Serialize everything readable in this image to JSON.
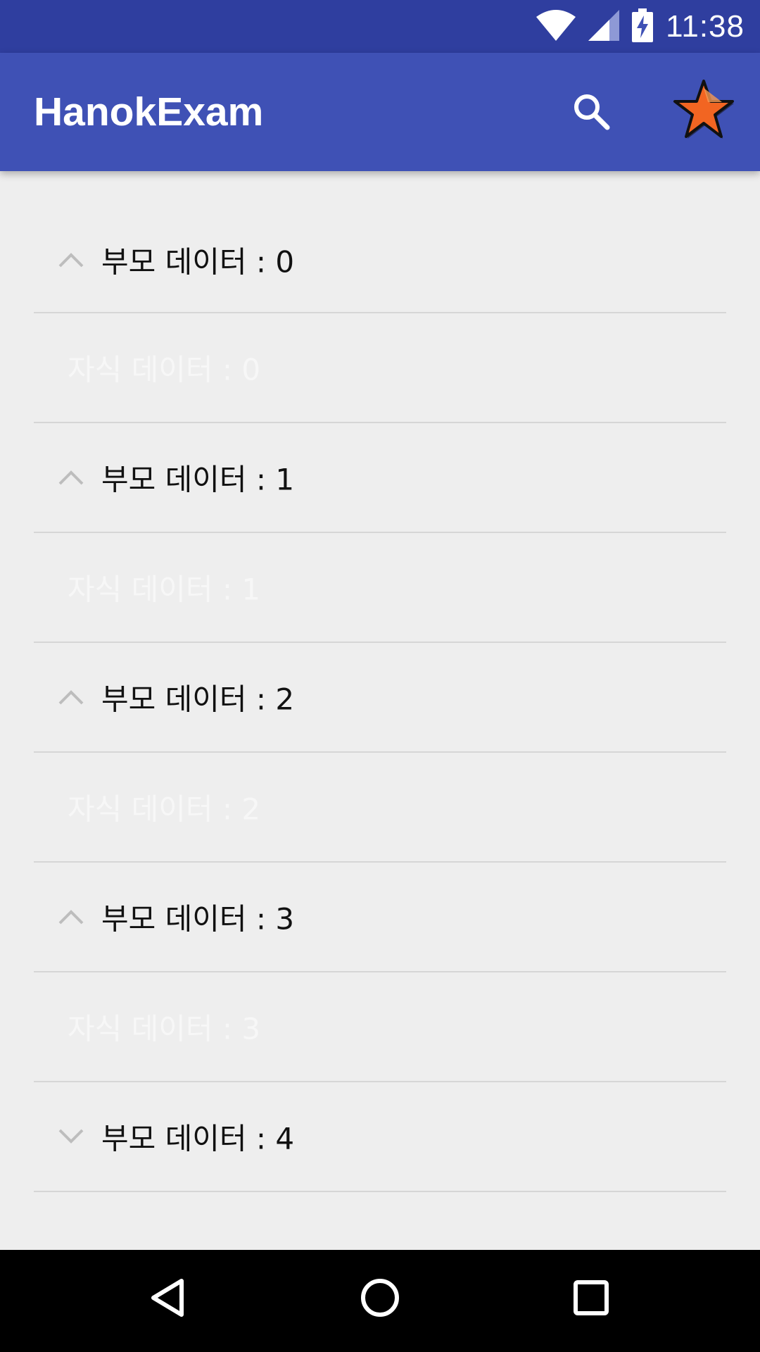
{
  "status_bar": {
    "time": "11:38",
    "icons": [
      "wifi-icon",
      "cell-signal-icon",
      "battery-charging-icon"
    ]
  },
  "app_bar": {
    "title": "HanokExam",
    "actions": [
      "search-icon",
      "star-icon"
    ],
    "colors": {
      "primary": "#3f51b5",
      "primary_dark": "#2f3e9f",
      "star": "#f26522"
    }
  },
  "list": {
    "items": [
      {
        "type": "parent",
        "label": "부모 데이터 : 0",
        "expanded": true
      },
      {
        "type": "child",
        "label": "자식 데이터 : 0"
      },
      {
        "type": "parent",
        "label": "부모 데이터 : 1",
        "expanded": true
      },
      {
        "type": "child",
        "label": "자식 데이터 : 1"
      },
      {
        "type": "parent",
        "label": "부모 데이터 : 2",
        "expanded": true
      },
      {
        "type": "child",
        "label": "자식 데이터 : 2"
      },
      {
        "type": "parent",
        "label": "부모 데이터 : 3",
        "expanded": true
      },
      {
        "type": "child",
        "label": "자식 데이터 : 3"
      },
      {
        "type": "parent",
        "label": "부모 데이터 : 4",
        "expanded": false
      }
    ]
  },
  "nav_bar": {
    "buttons": [
      "back-icon",
      "home-icon",
      "recents-icon"
    ]
  }
}
